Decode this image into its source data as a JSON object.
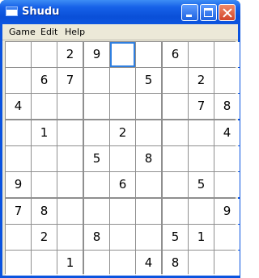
{
  "window": {
    "title": "Shudu"
  },
  "menu": [
    "Game",
    "Edit",
    "Help"
  ],
  "board": [
    [
      "",
      "",
      "2",
      "9",
      "",
      "",
      "6",
      "",
      ""
    ],
    [
      "",
      "6",
      "7",
      "",
      "",
      "5",
      "",
      "2",
      ""
    ],
    [
      "4",
      "",
      "",
      "",
      "",
      "",
      "",
      "7",
      "8"
    ],
    [
      "",
      "1",
      "",
      "",
      "2",
      "",
      "",
      "",
      "4"
    ],
    [
      "",
      "",
      "",
      "5",
      "",
      "8",
      "",
      "",
      ""
    ],
    [
      "9",
      "",
      "",
      "",
      "6",
      "",
      "",
      "5",
      ""
    ],
    [
      "7",
      "8",
      "",
      "",
      "",
      "",
      "",
      "",
      "9"
    ],
    [
      "",
      "2",
      "",
      "8",
      "",
      "",
      "5",
      "1",
      ""
    ],
    [
      "",
      "",
      "1",
      "",
      "",
      "4",
      "8",
      "",
      ""
    ]
  ],
  "selected": {
    "row": 0,
    "col": 4
  },
  "colors": {
    "titlebar": "#0a53df",
    "selection": "#2f7fe0",
    "grid_lines": "#8f8f8f"
  }
}
